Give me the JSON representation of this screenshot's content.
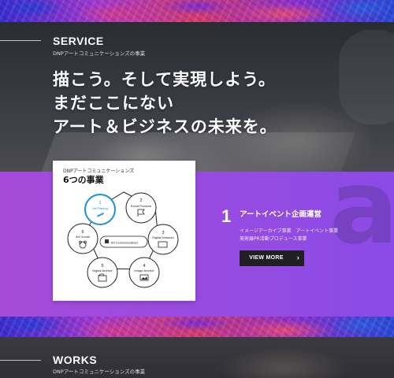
{
  "service": {
    "title": "SERVICE",
    "subtitle": "DNPアートコミュニケーションズの事業",
    "headline": "描こう。そして実現しよう。\nまだここにない\nアート＆ビジネスの未来を。"
  },
  "diagram": {
    "subtitle": "DNPアートコミュニケーションズ",
    "title": "6つの事業",
    "center_label": "Art Communications",
    "nodes": [
      {
        "num": "1",
        "label": "Art Planing",
        "icon": "pencil-icon",
        "active": true
      },
      {
        "num": "2",
        "label": "Event Produce",
        "icon": "flag-icon",
        "active": false
      },
      {
        "num": "3",
        "label": "Digital Museum",
        "icon": "monitor-icon",
        "active": false
      },
      {
        "num": "4",
        "label": "Image Archive",
        "icon": "image-icon",
        "active": false
      },
      {
        "num": "5",
        "label": "Digital Archive",
        "icon": "folder-icon",
        "active": false
      },
      {
        "num": "6",
        "label": "Art Goods",
        "icon": "bear-icon",
        "active": false
      }
    ]
  },
  "detail": {
    "number": "1",
    "title": "アートイベント企画運営",
    "lines": [
      "イメージアーカイブ事業　アートイベント事業",
      "美術展PR活動プロデュース事業"
    ],
    "button_label": "VIEW MORE",
    "button_icon": "chevron-right-icon"
  },
  "works": {
    "title": "WORKS",
    "subtitle": "DNPアートコミュニケーションズの事業"
  },
  "colors": {
    "accent_blue": "#1e90d8",
    "band_purple": "#9a4be0",
    "button_dark": "#1f1f24"
  }
}
